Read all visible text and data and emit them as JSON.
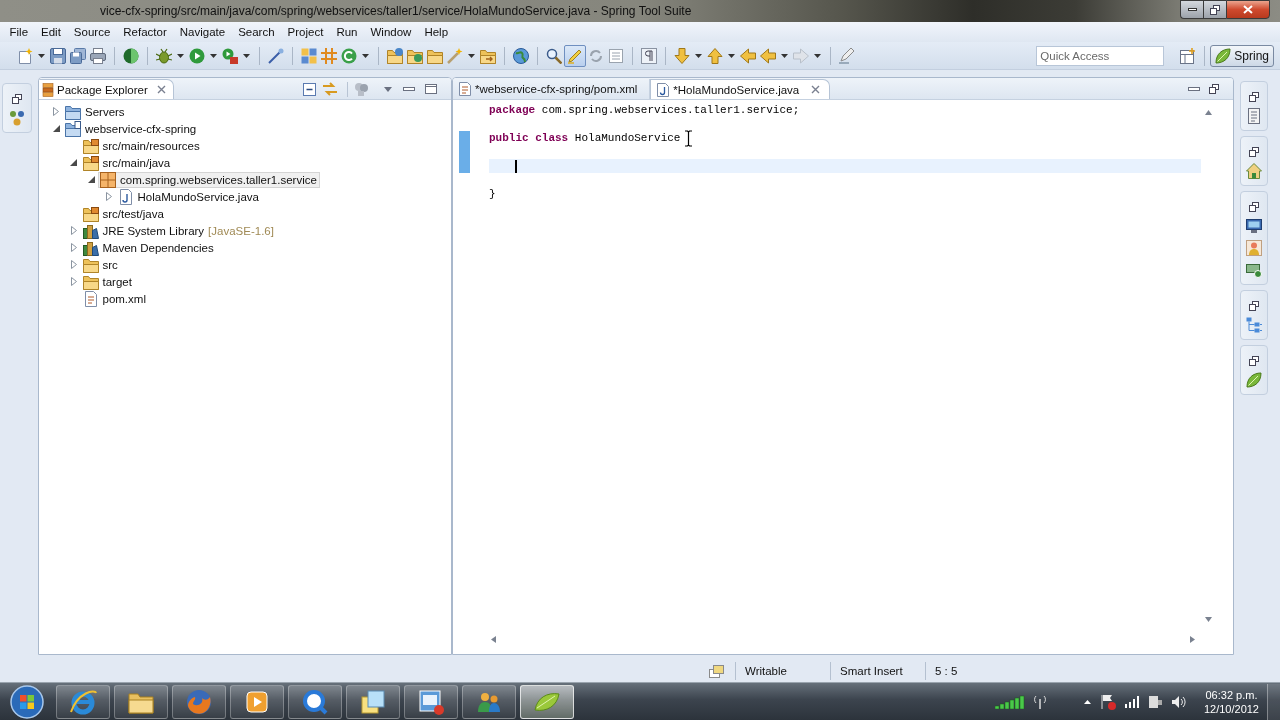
{
  "window": {
    "title": "vice-cfx-spring/src/main/java/com/spring/webservices/taller1/service/HolaMundoService.java - Spring Tool Suite"
  },
  "menu": [
    "File",
    "Edit",
    "Source",
    "Refactor",
    "Navigate",
    "Search",
    "Project",
    "Run",
    "Window",
    "Help"
  ],
  "toolbar": {
    "highlight_toggle": {
      "pressed": true
    },
    "quick_access": {
      "placeholder": "Quick Access"
    },
    "perspective": {
      "label": "Spring",
      "selected": true
    }
  },
  "package_explorer": {
    "title": "Package Explorer",
    "tree": [
      {
        "kind": "server-folder",
        "label": "Servers",
        "expanded": false,
        "selected": false
      },
      {
        "kind": "project",
        "label": "webservice-cfx-spring",
        "expanded": true,
        "selected": false,
        "children": [
          {
            "kind": "source-folder",
            "label": "src/main/resources",
            "selected": false
          },
          {
            "kind": "source-folder",
            "label": "src/main/java",
            "expanded": true,
            "selected": false,
            "children": [
              {
                "kind": "package",
                "label": "com.spring.webservices.taller1.service",
                "expanded": true,
                "selected": true,
                "children": [
                  {
                    "kind": "java-file",
                    "label": "HolaMundoService.java",
                    "expanded": false,
                    "selected": false
                  }
                ]
              }
            ]
          },
          {
            "kind": "source-folder",
            "label": "src/test/java",
            "selected": false
          },
          {
            "kind": "library",
            "label": "JRE System Library",
            "decoration": "[JavaSE-1.6]",
            "expanded": false,
            "selected": false
          },
          {
            "kind": "library",
            "label": "Maven Dependencies",
            "expanded": false,
            "selected": false
          },
          {
            "kind": "folder",
            "label": "src",
            "expanded": false,
            "selected": false
          },
          {
            "kind": "folder",
            "label": "target",
            "expanded": false,
            "selected": false
          },
          {
            "kind": "xml-file",
            "label": "pom.xml",
            "selected": false
          }
        ]
      }
    ]
  },
  "editor": {
    "tabs": [
      {
        "kind": "xml-file",
        "label": "*webservice-cfx-spring/pom.xml",
        "selected": false
      },
      {
        "kind": "java-file",
        "label": "*HolaMundoService.java",
        "selected": true
      }
    ],
    "lines": [
      {
        "text": "**package** com.spring.webservices.taller1.service;",
        "current": false,
        "changed": false
      },
      {
        "text": "**public** **class** HolaMundoService",
        "current": false,
        "changed": true
      },
      {
        "current": true,
        "changed": true
      },
      {
        "text": "}",
        "current": false,
        "changed": false
      }
    ]
  },
  "status_bar": {
    "items": [
      "Writable",
      "Smart Insert",
      "5 : 5"
    ]
  },
  "taskbar": {
    "apps": [
      {
        "kind": "browser",
        "selected": false
      },
      {
        "kind": "files",
        "selected": false
      },
      {
        "kind": "web-browser",
        "selected": false
      },
      {
        "kind": "media",
        "selected": false
      },
      {
        "kind": "magnifier",
        "selected": false
      },
      {
        "kind": "notes",
        "selected": false
      },
      {
        "kind": "remote",
        "selected": false
      },
      {
        "kind": "people",
        "selected": false
      },
      {
        "kind": "leaf",
        "selected": true
      }
    ],
    "clock": {
      "time": "06:32 p.m.",
      "date": "12/10/2012"
    }
  }
}
